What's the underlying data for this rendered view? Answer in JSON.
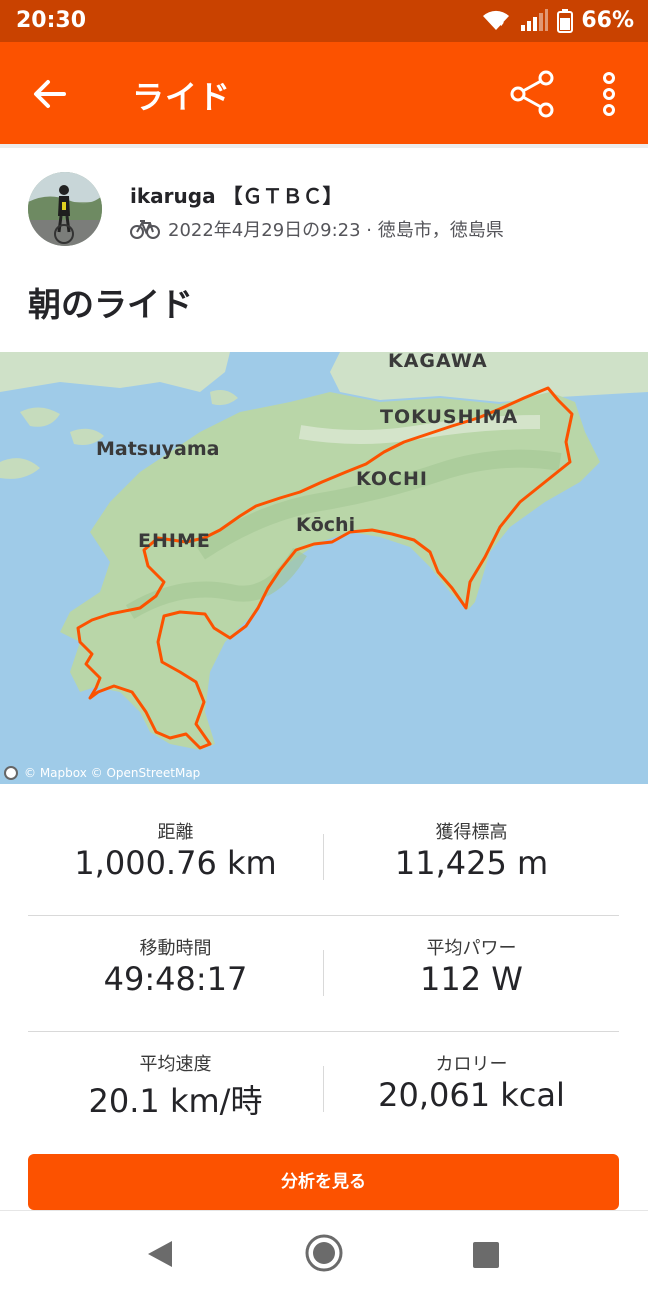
{
  "status_bar": {
    "time": "20:30",
    "battery": "66%",
    "icons": [
      "wifi-icon",
      "signal-icon",
      "battery-icon"
    ]
  },
  "app_bar": {
    "title": "ライド",
    "back_icon": "arrow-left-icon",
    "share_icon": "share-icon",
    "more_icon": "more-vertical-icon",
    "color": "#fc5200"
  },
  "athlete": {
    "name": "ikaruga 【ＧＴＢＣ】",
    "activity_icon": "bicycle-icon",
    "meta": "2022年4月29日の9:23 · 徳島市，徳島県"
  },
  "activity": {
    "title": "朝のライド"
  },
  "map": {
    "labels": {
      "kagawa": "KAGAWA",
      "tokushima": "TOKUSHIMA",
      "matsuyama": "Matsuyama",
      "kochi_pref": "KOCHI",
      "kochi_city": "Kōchi",
      "ehime": "EHIME"
    },
    "attribution": "© Mapbox © OpenStreetMap",
    "route_color": "#fc5200"
  },
  "stats": [
    {
      "left": {
        "label": "距離",
        "value": "1,000.76 km"
      },
      "right": {
        "label": "獲得標高",
        "value": "11,425 m"
      }
    },
    {
      "left": {
        "label": "移動時間",
        "value": "49:48:17"
      },
      "right": {
        "label": "平均パワー",
        "value": "112 W"
      }
    },
    {
      "left": {
        "label": "平均速度",
        "value": "20.1 km/時"
      },
      "right": {
        "label": "カロリー",
        "value": "20,061 kcal"
      }
    }
  ],
  "analysis_button": "分析を見る",
  "nav_bar": {
    "icons": [
      "nav-back-icon",
      "nav-home-icon",
      "nav-recent-apps-icon"
    ]
  }
}
